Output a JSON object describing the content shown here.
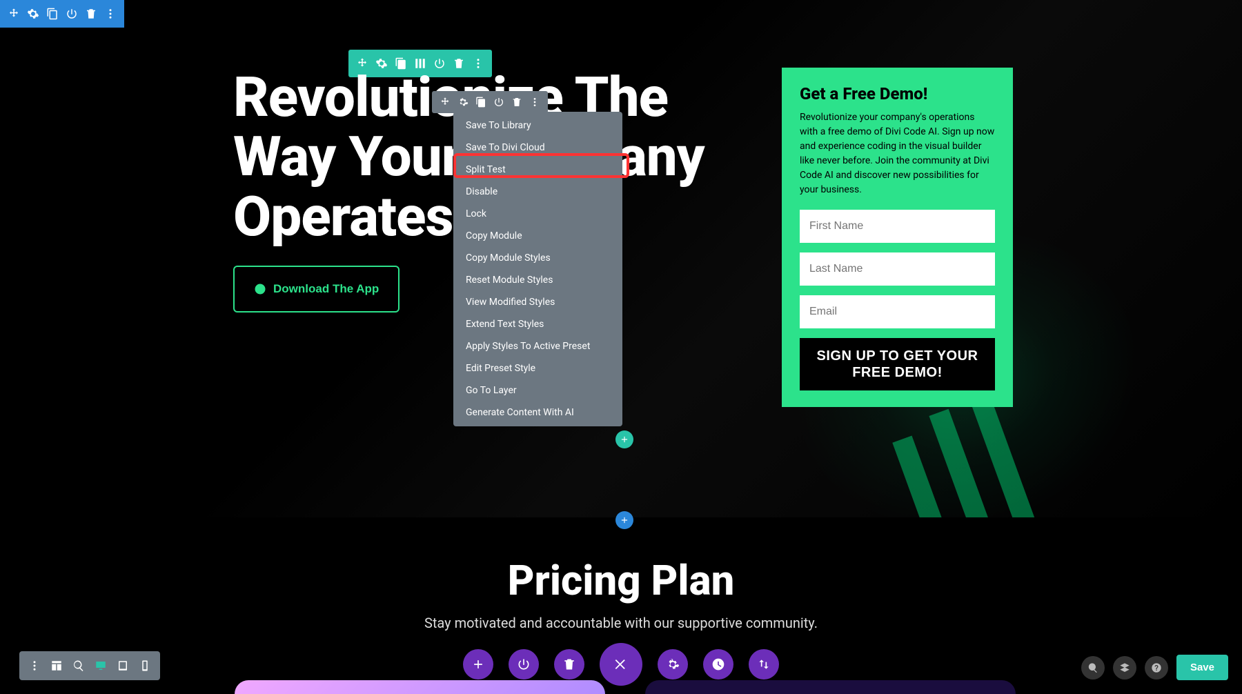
{
  "hero": {
    "headline": "Revolutionize The Way Your Company Operates",
    "download_label": "Download The App"
  },
  "demo_card": {
    "title": "Get a Free Demo!",
    "body": "Revolutionize your company's operations with a free demo of Divi Code AI. Sign up now and experience coding in the visual builder like never before. Join the community at Divi Code AI and discover new possibilities for your business.",
    "first_name_placeholder": "First Name",
    "last_name_placeholder": "Last Name",
    "email_placeholder": "Email",
    "submit_label": "SIGN UP TO GET YOUR FREE DEMO!"
  },
  "context_menu": {
    "items": [
      "Save To Library",
      "Save To Divi Cloud",
      "Split Test",
      "Disable",
      "Lock",
      "Copy Module",
      "Copy Module Styles",
      "Reset Module Styles",
      "View Modified Styles",
      "Extend Text Styles",
      "Apply Styles To Active Preset",
      "Edit Preset Style",
      "Go To Layer",
      "Generate Content With AI"
    ],
    "highlighted_index": 2
  },
  "pricing": {
    "title": "Pricing Plan",
    "subtitle": "Stay motivated and accountable with our supportive community."
  },
  "bottom_right": {
    "save_label": "Save"
  },
  "colors": {
    "brand_green": "#2ce28b",
    "row_teal": "#29c4a9",
    "section_blue": "#2b87da",
    "builder_purple": "#6c2eb9",
    "toolbar_gray": "#6c7781",
    "highlight_red": "#ff3333"
  }
}
